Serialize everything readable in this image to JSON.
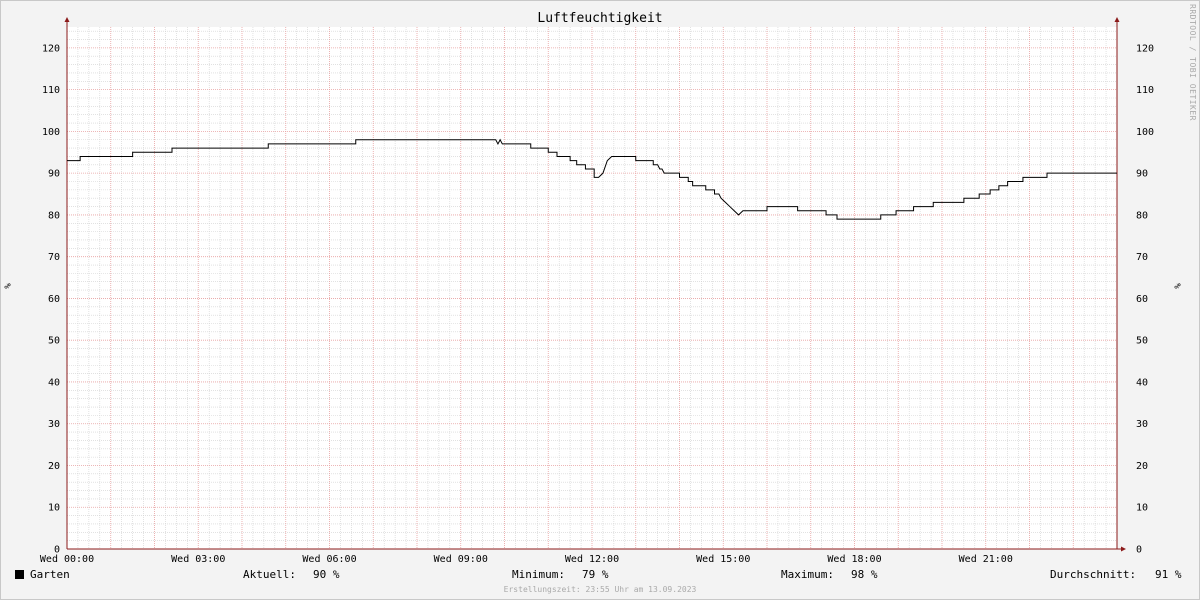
{
  "chart_data": {
    "type": "line",
    "title": "Luftfeuchtigkeit",
    "ylabel": "%",
    "ylim": [
      0,
      125
    ],
    "yticks": [
      0,
      10,
      20,
      30,
      40,
      50,
      60,
      70,
      80,
      90,
      100,
      110,
      120
    ],
    "xlim_hours": [
      0,
      24
    ],
    "xticks": [
      {
        "h": 0,
        "label": "Wed 00:00"
      },
      {
        "h": 3,
        "label": "Wed 03:00"
      },
      {
        "h": 6,
        "label": "Wed 06:00"
      },
      {
        "h": 9,
        "label": "Wed 09:00"
      },
      {
        "h": 12,
        "label": "Wed 12:00"
      },
      {
        "h": 15,
        "label": "Wed 15:00"
      },
      {
        "h": 18,
        "label": "Wed 18:00"
      },
      {
        "h": 21,
        "label": "Wed 21:00"
      }
    ],
    "grid": true,
    "series": [
      {
        "name": "Garten",
        "color": "#000000",
        "x_hours": [
          0,
          0.3,
          0.3,
          1.5,
          1.5,
          2.4,
          2.4,
          4.6,
          4.6,
          6.6,
          6.6,
          9.8,
          9.85,
          9.9,
          9.95,
          10.6,
          10.6,
          11.0,
          11.0,
          11.2,
          11.2,
          11.5,
          11.5,
          11.65,
          11.65,
          11.85,
          11.85,
          12.05,
          12.05,
          12.15,
          12.25,
          12.35,
          12.45,
          12.55,
          12.55,
          13.0,
          13.0,
          13.4,
          13.4,
          13.5,
          13.55,
          13.6,
          13.65,
          13.7,
          13.75,
          14.0,
          14.0,
          14.2,
          14.2,
          14.3,
          14.3,
          14.6,
          14.6,
          14.8,
          14.8,
          14.9,
          14.95,
          15.05,
          15.15,
          15.25,
          15.35,
          15.45,
          15.5,
          16.0,
          16.0,
          16.7,
          16.7,
          17.35,
          17.35,
          17.6,
          17.6,
          17.7,
          17.7,
          18.6,
          18.6,
          18.95,
          18.95,
          19.35,
          19.35,
          19.8,
          19.8,
          20.5,
          20.5,
          20.85,
          20.85,
          21.1,
          21.1,
          21.3,
          21.3,
          21.5,
          21.5,
          21.85,
          21.85,
          22.4,
          22.4,
          22.7,
          22.7,
          24.0
        ],
        "y": [
          93,
          93,
          94,
          94,
          95,
          95,
          96,
          96,
          97,
          97,
          98,
          98,
          97,
          98,
          97,
          97,
          96,
          96,
          95,
          95,
          94,
          94,
          93,
          93,
          92,
          92,
          91,
          91,
          89,
          89,
          90,
          93,
          94,
          94,
          94,
          94,
          93,
          93,
          92,
          92,
          91,
          91,
          90,
          90,
          90,
          90,
          89,
          89,
          88,
          88,
          87,
          87,
          86,
          86,
          85,
          85,
          84,
          83,
          82,
          81,
          80,
          81,
          81,
          81,
          82,
          82,
          81,
          81,
          80,
          80,
          79,
          79,
          79,
          79,
          80,
          80,
          81,
          81,
          82,
          82,
          83,
          83,
          84,
          84,
          85,
          85,
          86,
          86,
          87,
          87,
          88,
          88,
          89,
          89,
          90,
          90,
          90,
          90
        ]
      }
    ]
  },
  "legend": {
    "series_name": "Garten",
    "current_label": "Aktuell:",
    "current_value": "90 %",
    "min_label": "Minimum:",
    "min_value": "79 %",
    "max_label": "Maximum:",
    "max_value": "98 %",
    "avg_label": "Durchschnitt:",
    "avg_value": "91 %"
  },
  "watermark": "RRDTOOL / TOBI OETIKER",
  "timestamp": "Erstellungszeit: 23:55 Uhr am 13.09.2023",
  "colors": {
    "background": "#f3f3f3",
    "canvas": "#ffffff",
    "major_grid": "#e8a0a0",
    "minor_grid": "#d0d0d0",
    "axis": "#8b1a1a",
    "line": "#000000"
  }
}
